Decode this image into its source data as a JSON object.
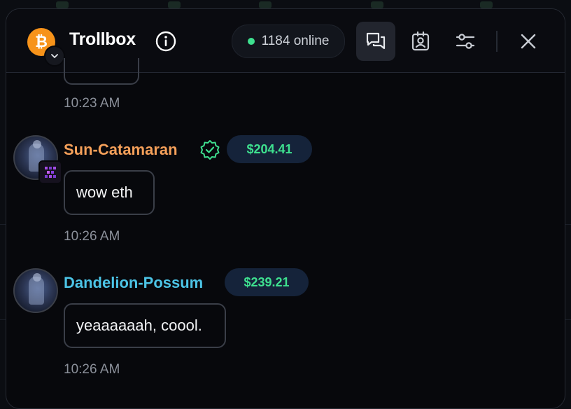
{
  "header": {
    "title": "Trollbox",
    "online_count": "1184 online",
    "coin_symbol": "₿"
  },
  "messages": [
    {
      "timestamp": "10:23 AM"
    },
    {
      "username": "Sun-Catamaran",
      "username_color": "#f5a05a",
      "verified": true,
      "balance": "$204.41",
      "text": "wow eth",
      "timestamp": "10:26 AM"
    },
    {
      "username": "Dandelion-Possum",
      "username_color": "#4cc4e6",
      "verified": false,
      "balance": "$239.21",
      "text": "yeaaaaaah, coool.",
      "timestamp": "10:26 AM"
    }
  ],
  "colors": {
    "online": "#3ee08f",
    "balance": "#3ee08f",
    "bitcoin": "#f7931a"
  }
}
